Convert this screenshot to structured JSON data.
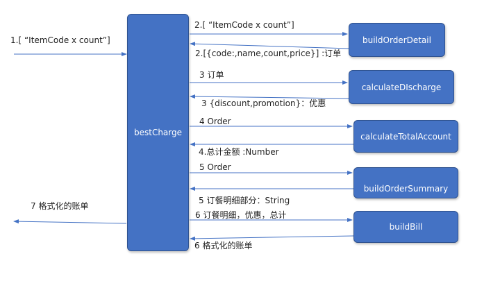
{
  "nodes": {
    "bestCharge": "bestCharge",
    "buildOrderDetail": "buildOrderDetail",
    "calculateDiscount": "calculateDIscharge",
    "calculateTotalAccount": "calculateTotalAccount",
    "buildOrderSummary": "buildOrderSummary",
    "buildBill": "buildBill"
  },
  "messages": {
    "input": "1.[ “ItemCode x count”]",
    "call_order_detail": "2.[ “ItemCode x count”]",
    "return_order_detail": "2.[{code:,name,count,price}] :订单",
    "call_discount": "3 订单",
    "return_discount": "3 {discount,promotion}：优惠",
    "call_total": "4 Order",
    "return_total": "4.总计金额 :Number",
    "call_summary": "5 Order",
    "return_summary": "5 订餐明细部分：String",
    "call_bill": "6 订餐明细，优惠，总计",
    "return_bill": "6 格式化的账单",
    "output": "7 格式化的账单"
  },
  "colors": {
    "box_fill": "#4472c4",
    "box_border": "#2f528f",
    "arrow": "#4472c4",
    "text": "#222222"
  }
}
